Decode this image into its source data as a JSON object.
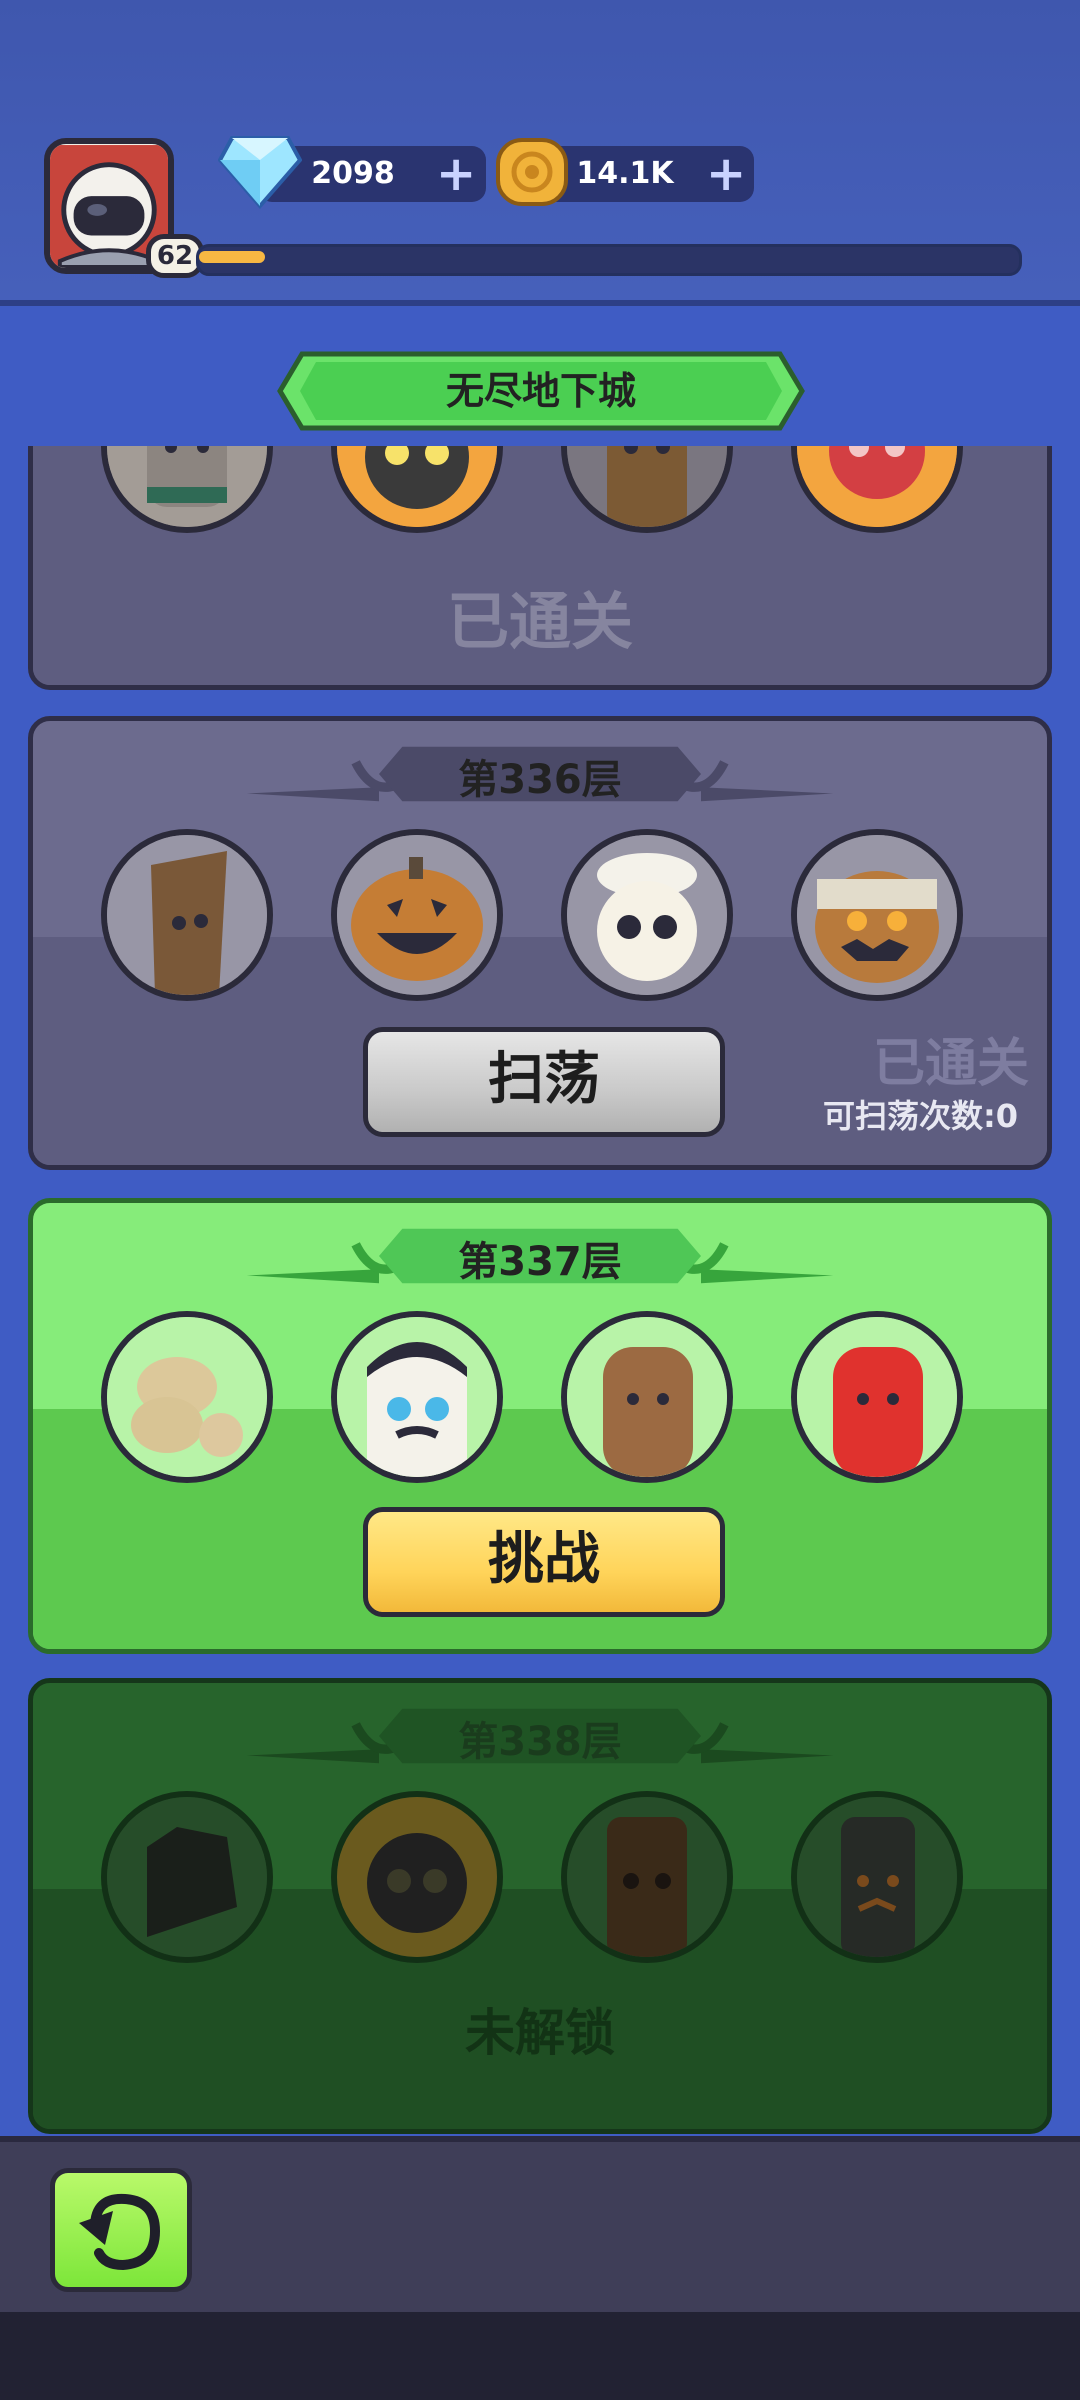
{
  "header": {
    "player_level": "62",
    "xp_progress": 0.08,
    "gems": {
      "value": "2098",
      "icon": "diamond-icon"
    },
    "coins": {
      "value": "14.1K",
      "icon": "coin-icon"
    },
    "plus_symbol": "+"
  },
  "title": "无尽地下城",
  "floors": [
    {
      "label": "",
      "status": "已通关",
      "state": "cleared-partial"
    },
    {
      "label": "第336层",
      "status": "已通关",
      "sweep_count": "可扫荡次数:0",
      "button": "扫荡",
      "state": "cleared"
    },
    {
      "label": "第337层",
      "button": "挑战",
      "state": "current"
    },
    {
      "label": "第338层",
      "status": "未解锁",
      "state": "locked"
    }
  ],
  "colors": {
    "cleared_card": "#6c6b8e",
    "current_card": "#86ec7a",
    "locked_card": "#27642c",
    "challenge_button": "#ffd45a",
    "sweep_button": "#c9c9c9"
  },
  "bottom": {
    "back_icon": "back-arrow-icon"
  }
}
